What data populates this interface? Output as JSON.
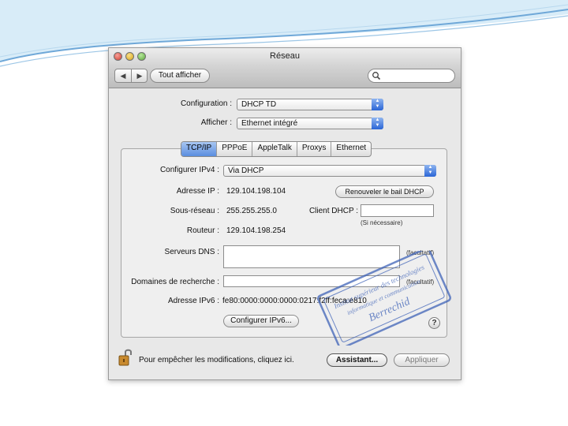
{
  "window": {
    "title": "Réseau"
  },
  "toolbar": {
    "back_glyph": "◀",
    "forward_glyph": "▶",
    "show_all_label": "Tout afficher",
    "search_icon": "magnifier-icon",
    "search_value": ""
  },
  "top_form": {
    "configuration_label": "Configuration :",
    "configuration_value": "DHCP TD",
    "afficher_label": "Afficher :",
    "afficher_value": "Ethernet intégré"
  },
  "tabs": [
    "TCP/IP",
    "PPPoE",
    "AppleTalk",
    "Proxys",
    "Ethernet"
  ],
  "active_tab": "TCP/IP",
  "tcpip": {
    "configurer_ipv4_label": "Configurer IPv4 :",
    "configurer_ipv4_value": "Via DHCP",
    "adresse_ip_label": "Adresse IP :",
    "adresse_ip_value": "129.104.198.104",
    "renew_button": "Renouveler le bail DHCP",
    "sous_reseau_label": "Sous-réseau :",
    "sous_reseau_value": "255.255.255.0",
    "client_dhcp_label": "Client DHCP :",
    "client_dhcp_value": "",
    "si_necessaire": "(Si nécessaire)",
    "routeur_label": "Routeur :",
    "routeur_value": "129.104.198.254",
    "dns_label": "Serveurs DNS :",
    "dns_value": "",
    "facultatif_1": "(facultatif)",
    "domaines_label": "Domaines de recherche :",
    "domaines_value": "",
    "facultatif_2": "(facultatif)",
    "ipv6_label": "Adresse IPv6 :",
    "ipv6_value": "fe80:0000:0000:0000:0217:f2ff:feca:e810",
    "configurer_ipv6_button": "Configurer IPv6...",
    "help_glyph": "?"
  },
  "footer": {
    "lock_icon": "padlock-icon",
    "lock_text": "Pour empêcher les modifications, cliquez ici.",
    "assistant_button": "Assistant...",
    "appliquer_button": "Appliquer"
  },
  "stamp": {
    "line1": "Institut supérieur des technologies",
    "line2": "informatique et communication",
    "line3": "Berrechid"
  },
  "colors": {
    "slide_accent": "#6fa8d8",
    "select_arrow": "#2a65d6",
    "active_tab": "#5a8ddf",
    "stamp_blue": "#3f63b8"
  }
}
